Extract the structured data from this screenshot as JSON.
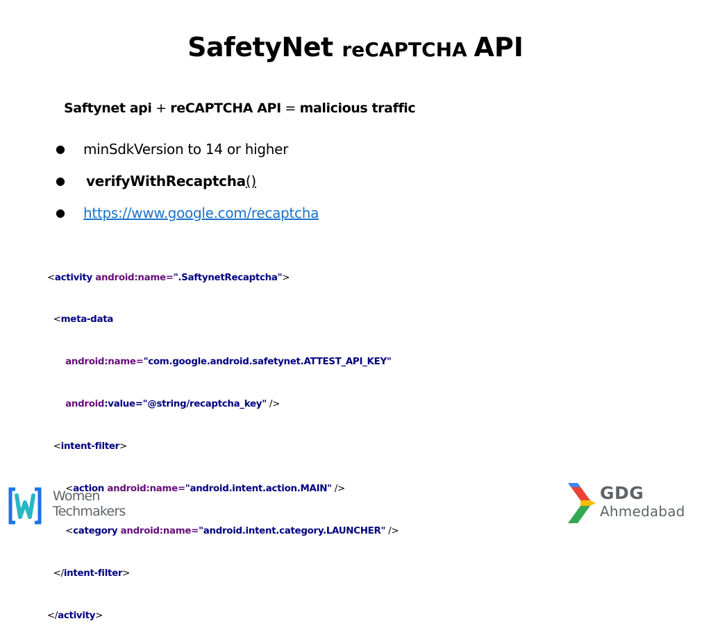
{
  "title": {
    "part1": "SafetyNet ",
    "part2": "reCAPTCHA ",
    "part3": "API"
  },
  "subtitle": {
    "a": "Saftynet api",
    "plus": " + ",
    "b": "reCAPTCHA API",
    "eq": " = ",
    "c": "malicious traffic"
  },
  "bullets": {
    "item1": "minSdkVersion to 14 or higher",
    "item2_name": "verifyWithRecaptcha",
    "item2_paren": "()",
    "item3_link": "https://www.google.com/recaptcha"
  },
  "code": {
    "l1": {
      "open": "<",
      "tag": "activity",
      "attr": " android:name=",
      "val": "\".SaftynetRecaptcha\"",
      "close": ">"
    },
    "l2": {
      "open": "<",
      "tag": "meta-data"
    },
    "l3": {
      "attr": "android:name=",
      "val": "\"com.google.android.safetynet.ATTEST_API_KEY\""
    },
    "l4": {
      "attr_a": "android",
      "attr_b": ":value=",
      "val": "\"@string/recaptcha_key\"",
      "close": " />"
    },
    "l5": {
      "open": "<",
      "tag": "intent-filter",
      "close": ">"
    },
    "l6": {
      "open": "<",
      "tag": "action",
      "attr": " android:name=",
      "val": "\"android.intent.action.MAIN\"",
      "close": " />"
    },
    "l7": {
      "open": "<",
      "tag": "category",
      "attr": " android:name=",
      "val": "\"android.intent.category.LAUNCHER\"",
      "close": " />"
    },
    "l8": {
      "open": "</",
      "tag": "intent-filter",
      "close": ">"
    },
    "l9": {
      "open": "</",
      "tag": "activity",
      "close": ">"
    }
  },
  "logos": {
    "wtm_line1": "Women",
    "wtm_line2": "Techmakers",
    "gdg_line1": "GDG",
    "gdg_line2": "Ahmedabad"
  },
  "colors": {
    "code_tag": "#000080",
    "code_attr": "#660e7a",
    "code_value": "#008000",
    "link": "#1a73c8"
  }
}
